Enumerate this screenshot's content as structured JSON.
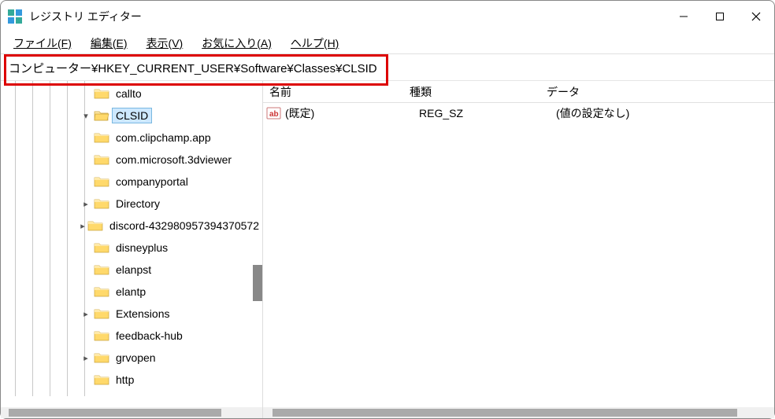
{
  "titlebar": {
    "title": "レジストリ エディター"
  },
  "menubar": {
    "file": "ファイル(F)",
    "edit": "編集(E)",
    "view": "表示(V)",
    "favorites": "お気に入り(A)",
    "help": "ヘルプ(H)"
  },
  "addressbar": {
    "path": "コンピューター¥HKEY_CURRENT_USER¥Software¥Classes¥CLSID"
  },
  "tree": {
    "items": [
      {
        "label": "callto",
        "expandable": false,
        "selected": false
      },
      {
        "label": "CLSID",
        "expandable": true,
        "selected": true
      },
      {
        "label": "com.clipchamp.app",
        "expandable": false,
        "selected": false
      },
      {
        "label": "com.microsoft.3dviewer",
        "expandable": false,
        "selected": false
      },
      {
        "label": "companyportal",
        "expandable": false,
        "selected": false
      },
      {
        "label": "Directory",
        "expandable": true,
        "selected": false
      },
      {
        "label": "discord-432980957394370572",
        "expandable": true,
        "selected": false
      },
      {
        "label": "disneyplus",
        "expandable": false,
        "selected": false
      },
      {
        "label": "elanpst",
        "expandable": false,
        "selected": false
      },
      {
        "label": "elantp",
        "expandable": false,
        "selected": false
      },
      {
        "label": "Extensions",
        "expandable": true,
        "selected": false
      },
      {
        "label": "feedback-hub",
        "expandable": false,
        "selected": false
      },
      {
        "label": "grvopen",
        "expandable": true,
        "selected": false
      },
      {
        "label": "http",
        "expandable": false,
        "selected": false
      }
    ]
  },
  "list": {
    "columns": {
      "name": "名前",
      "type": "種類",
      "data": "データ"
    },
    "rows": [
      {
        "name": "(既定)",
        "type": "REG_SZ",
        "data": "(値の設定なし)"
      }
    ]
  },
  "scrollbars": {
    "tree_h_thumb_width": 270,
    "list_h_thumb_width": 590
  }
}
